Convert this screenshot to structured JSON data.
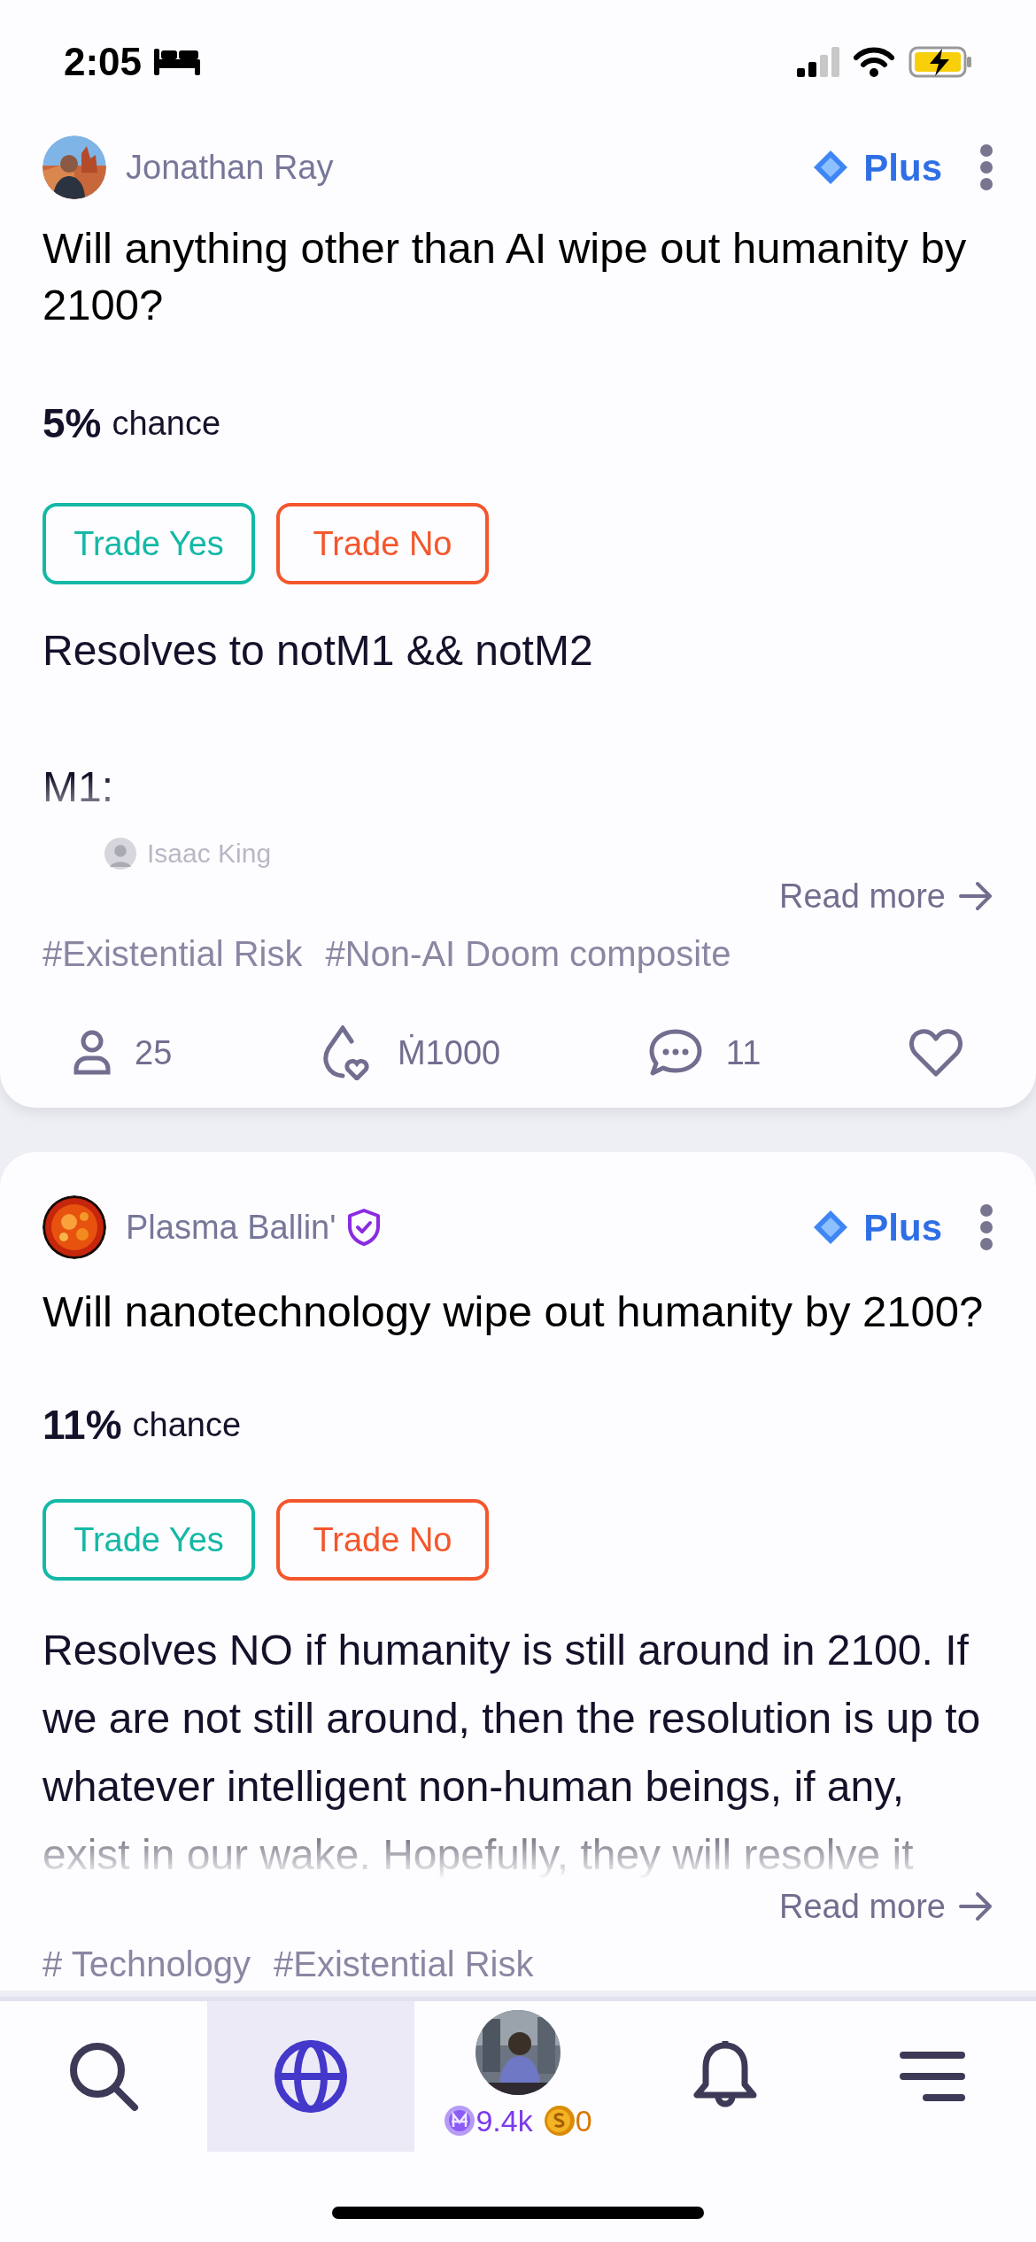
{
  "status_bar": {
    "time": "2:05"
  },
  "cards": [
    {
      "author": "Jonathan Ray",
      "verified": false,
      "plus_label": "Plus",
      "title": "Will anything other than AI wipe out humanity by 2100?",
      "probability": "5%",
      "probability_label": "chance",
      "buttons": [
        {
          "kind": "yes",
          "label": "Trade Yes"
        },
        {
          "kind": "no",
          "label": "Trade No"
        }
      ],
      "description": [
        "Resolves to notM1 && notM2",
        "M1:"
      ],
      "mention": "Isaac King",
      "read_more": "Read more",
      "tags": [
        "#Existential Risk",
        "#Non-AI Doom composite"
      ],
      "stats": {
        "traders": "25",
        "volume": "Ṁ1000",
        "comments": "11"
      }
    },
    {
      "author": "Plasma Ballin'",
      "verified": true,
      "plus_label": "Plus",
      "title": "Will nanotechnology wipe out humanity by 2100?",
      "probability": "11%",
      "probability_label": "chance",
      "buttons": [
        {
          "kind": "yes",
          "label": "Trade Yes"
        },
        {
          "kind": "no",
          "label": "Trade No"
        }
      ],
      "description": [
        "Resolves NO if humanity is still around in 2100. If we are not still around, then the resolution is up to whatever intelligent non-human beings, if any, exist in our wake. Hopefully, they will resolve it"
      ],
      "read_more": "Read more",
      "tags": [
        "# Technology",
        "#Existential Risk"
      ]
    }
  ],
  "nav": [
    {
      "kind": "search",
      "selected": false
    },
    {
      "kind": "globe",
      "selected": true
    },
    {
      "kind": "profile",
      "selected": false,
      "mana": "9.4k",
      "cash": "0"
    },
    {
      "kind": "bell",
      "selected": false
    },
    {
      "kind": "menu",
      "selected": false
    }
  ]
}
